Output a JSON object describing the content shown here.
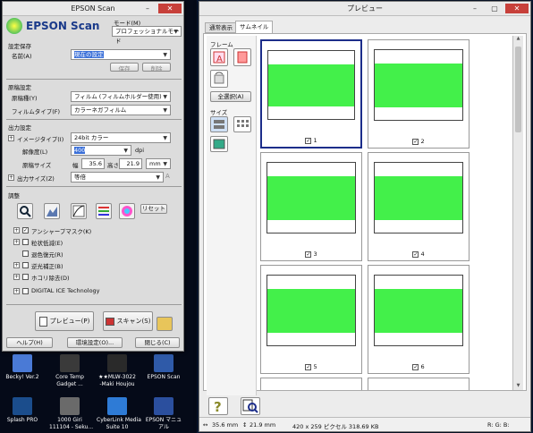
{
  "desktop": {
    "icons": [
      {
        "label": "Becky! Ver.2",
        "color": "#4a7ad6"
      },
      {
        "label": "Core Temp\nGadget ...",
        "color": "#3a3a3a"
      },
      {
        "label": "★★MLW-3022\n-Maki Houjou",
        "color": "#2a2a2a"
      },
      {
        "label": "EPSON Scan",
        "color": "#2f5aa8"
      },
      {
        "label": "Splash PRO",
        "color": "#1b4d8c"
      },
      {
        "label": "1000 Giri\n111104 - Seku...",
        "color": "#6a6a6a"
      },
      {
        "label": "CyberLink Media\nSuite 10",
        "color": "#2e7bd6"
      },
      {
        "label": "EPSON マニュアル",
        "color": "#2b4f9e"
      }
    ]
  },
  "scan": {
    "title": "EPSON Scan",
    "logo": "EPSON Scan",
    "mode_label": "モード(M)",
    "mode_value": "プロフェッショナルモード",
    "preset": {
      "section": "設定保存",
      "name_label": "名前(A)",
      "name_value": "現在の設定",
      "save": "保存",
      "delete": "削除"
    },
    "original": {
      "section": "原稿設定",
      "doc_type_label": "原稿種(Y)",
      "doc_type_value": "フィルム (フィルムホルダー使用)",
      "film_type_label": "フィルムタイプ(F)",
      "film_type_value": "カラーネガフィルム"
    },
    "output": {
      "section": "出力設定",
      "image_type_label": "イメージタイプ(I)",
      "image_type_value": "24bit カラー",
      "res_label": "解像度(L)",
      "res_value": "400",
      "res_unit": "dpi",
      "size_label": "原稿サイズ",
      "width_label": "幅",
      "width_value": "35.6",
      "height_label": "高さ",
      "height_value": "21.9",
      "unit": "mm",
      "outsize_label": "出力サイズ(Z)",
      "outsize_value": "等倍"
    },
    "adjust": {
      "section": "調整",
      "reset": "リセット",
      "items": [
        "アンシャープマスク(K)",
        "粒状低減(E)",
        "退色復元(R)",
        "逆光補正(B)",
        "ホコリ除去(D)",
        "DIGITAL ICE Technology"
      ],
      "checked": [
        true,
        false,
        false,
        false,
        false,
        false
      ]
    },
    "preview_btn": "プレビュー(P)",
    "scan_btn": "スキャン(S)",
    "help": "ヘルプ(H)",
    "config": "環境設定(O)...",
    "close": "閉じる(C)"
  },
  "preview": {
    "title": "プレビュー",
    "tabs": [
      "通常表示",
      "サムネイル"
    ],
    "frame_label": "フレーム",
    "select_all": "全選択(A)",
    "size_label": "サイズ",
    "thumbs": [
      {
        "n": "1",
        "checked": true,
        "selected": true
      },
      {
        "n": "2",
        "checked": true,
        "selected": false
      },
      {
        "n": "3",
        "checked": true,
        "selected": false
      },
      {
        "n": "4",
        "checked": true,
        "selected": false
      },
      {
        "n": "5",
        "checked": true,
        "selected": false
      },
      {
        "n": "6",
        "checked": true,
        "selected": false
      }
    ],
    "status": {
      "w": "35.6 mm",
      "h": "21.9 mm",
      "info": "420 x 259 ピクセル 318.69 KB",
      "rgb": "R:  G:  B:"
    }
  }
}
